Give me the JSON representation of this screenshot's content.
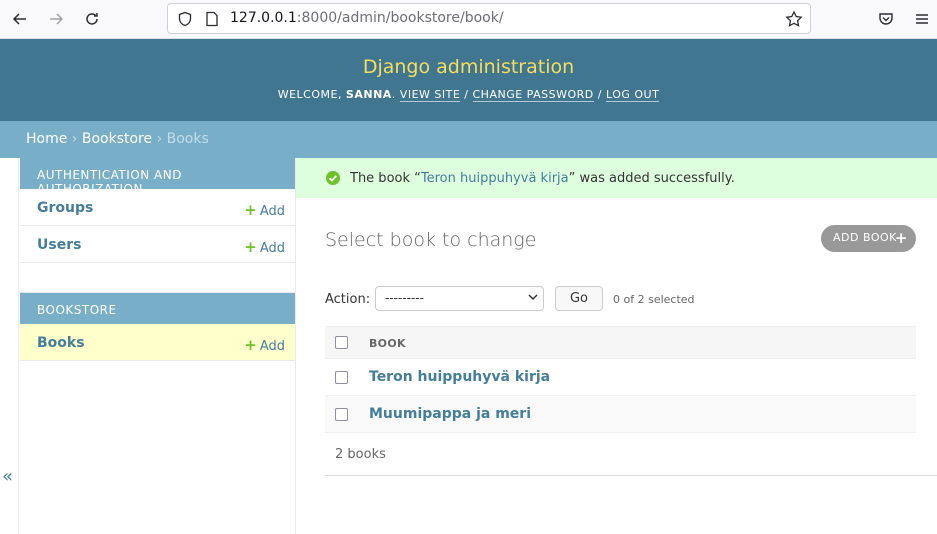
{
  "browser": {
    "url_host": "127.0.0.1",
    "url_rest": ":8000/admin/bookstore/book/"
  },
  "header": {
    "branding": "Django administration",
    "welcome": "WELCOME,",
    "username": "SANNA",
    "view_site": "VIEW SITE",
    "change_password": "CHANGE PASSWORD",
    "log_out": "LOG OUT"
  },
  "breadcrumbs": {
    "home": "Home",
    "app": "Bookstore",
    "current": "Books",
    "sep": "›"
  },
  "sidebar": {
    "auth_caption": "AUTHENTICATION AND AUTHORIZATION",
    "auth_items": [
      {
        "label": "Groups",
        "add": "Add"
      },
      {
        "label": "Users",
        "add": "Add"
      }
    ],
    "bookstore_caption": "BOOKSTORE",
    "bookstore_items": [
      {
        "label": "Books",
        "add": "Add"
      }
    ],
    "collapse": "«"
  },
  "message": {
    "prefix": "The book “",
    "link": "Teron huippuhyvä kirja",
    "suffix": "” was added successfully."
  },
  "main": {
    "title": "Select book to change",
    "add_button": "ADD BOOK",
    "action_label": "Action:",
    "action_selected": "---------",
    "go": "Go",
    "counter": "0 of 2 selected",
    "column_header": "BOOK",
    "rows": [
      {
        "title": "Teron huippuhyvä kirja"
      },
      {
        "title": "Muumipappa ja meri"
      }
    ],
    "paginator": "2 books"
  },
  "colors": {
    "header_bg": "#417690",
    "branding": "#f5dd5d",
    "breadcrumb_bg": "#79aec8",
    "link": "#447e9b",
    "success_bg": "#dfd",
    "selected_bg": "#ffffcc"
  }
}
